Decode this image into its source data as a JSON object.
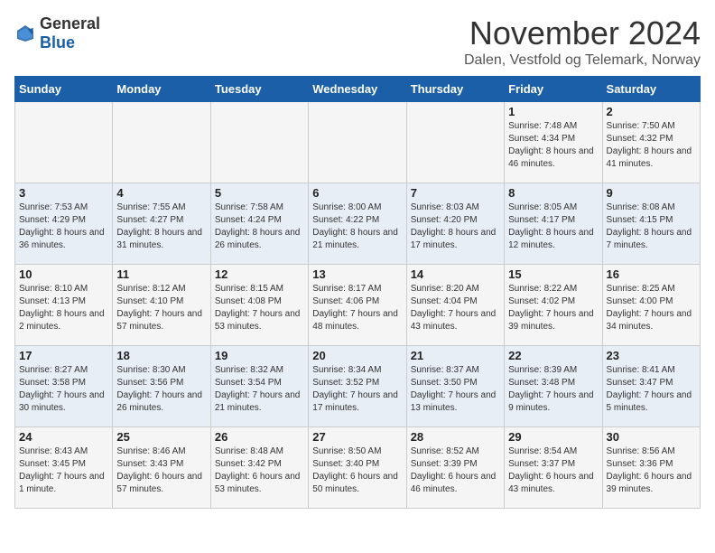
{
  "header": {
    "logo_general": "General",
    "logo_blue": "Blue",
    "month_title": "November 2024",
    "subtitle": "Dalen, Vestfold og Telemark, Norway"
  },
  "days_of_week": [
    "Sunday",
    "Monday",
    "Tuesday",
    "Wednesday",
    "Thursday",
    "Friday",
    "Saturday"
  ],
  "weeks": [
    [
      {
        "day": "",
        "info": ""
      },
      {
        "day": "",
        "info": ""
      },
      {
        "day": "",
        "info": ""
      },
      {
        "day": "",
        "info": ""
      },
      {
        "day": "",
        "info": ""
      },
      {
        "day": "1",
        "info": "Sunrise: 7:48 AM\nSunset: 4:34 PM\nDaylight: 8 hours and 46 minutes."
      },
      {
        "day": "2",
        "info": "Sunrise: 7:50 AM\nSunset: 4:32 PM\nDaylight: 8 hours and 41 minutes."
      }
    ],
    [
      {
        "day": "3",
        "info": "Sunrise: 7:53 AM\nSunset: 4:29 PM\nDaylight: 8 hours and 36 minutes."
      },
      {
        "day": "4",
        "info": "Sunrise: 7:55 AM\nSunset: 4:27 PM\nDaylight: 8 hours and 31 minutes."
      },
      {
        "day": "5",
        "info": "Sunrise: 7:58 AM\nSunset: 4:24 PM\nDaylight: 8 hours and 26 minutes."
      },
      {
        "day": "6",
        "info": "Sunrise: 8:00 AM\nSunset: 4:22 PM\nDaylight: 8 hours and 21 minutes."
      },
      {
        "day": "7",
        "info": "Sunrise: 8:03 AM\nSunset: 4:20 PM\nDaylight: 8 hours and 17 minutes."
      },
      {
        "day": "8",
        "info": "Sunrise: 8:05 AM\nSunset: 4:17 PM\nDaylight: 8 hours and 12 minutes."
      },
      {
        "day": "9",
        "info": "Sunrise: 8:08 AM\nSunset: 4:15 PM\nDaylight: 8 hours and 7 minutes."
      }
    ],
    [
      {
        "day": "10",
        "info": "Sunrise: 8:10 AM\nSunset: 4:13 PM\nDaylight: 8 hours and 2 minutes."
      },
      {
        "day": "11",
        "info": "Sunrise: 8:12 AM\nSunset: 4:10 PM\nDaylight: 7 hours and 57 minutes."
      },
      {
        "day": "12",
        "info": "Sunrise: 8:15 AM\nSunset: 4:08 PM\nDaylight: 7 hours and 53 minutes."
      },
      {
        "day": "13",
        "info": "Sunrise: 8:17 AM\nSunset: 4:06 PM\nDaylight: 7 hours and 48 minutes."
      },
      {
        "day": "14",
        "info": "Sunrise: 8:20 AM\nSunset: 4:04 PM\nDaylight: 7 hours and 43 minutes."
      },
      {
        "day": "15",
        "info": "Sunrise: 8:22 AM\nSunset: 4:02 PM\nDaylight: 7 hours and 39 minutes."
      },
      {
        "day": "16",
        "info": "Sunrise: 8:25 AM\nSunset: 4:00 PM\nDaylight: 7 hours and 34 minutes."
      }
    ],
    [
      {
        "day": "17",
        "info": "Sunrise: 8:27 AM\nSunset: 3:58 PM\nDaylight: 7 hours and 30 minutes."
      },
      {
        "day": "18",
        "info": "Sunrise: 8:30 AM\nSunset: 3:56 PM\nDaylight: 7 hours and 26 minutes."
      },
      {
        "day": "19",
        "info": "Sunrise: 8:32 AM\nSunset: 3:54 PM\nDaylight: 7 hours and 21 minutes."
      },
      {
        "day": "20",
        "info": "Sunrise: 8:34 AM\nSunset: 3:52 PM\nDaylight: 7 hours and 17 minutes."
      },
      {
        "day": "21",
        "info": "Sunrise: 8:37 AM\nSunset: 3:50 PM\nDaylight: 7 hours and 13 minutes."
      },
      {
        "day": "22",
        "info": "Sunrise: 8:39 AM\nSunset: 3:48 PM\nDaylight: 7 hours and 9 minutes."
      },
      {
        "day": "23",
        "info": "Sunrise: 8:41 AM\nSunset: 3:47 PM\nDaylight: 7 hours and 5 minutes."
      }
    ],
    [
      {
        "day": "24",
        "info": "Sunrise: 8:43 AM\nSunset: 3:45 PM\nDaylight: 7 hours and 1 minute."
      },
      {
        "day": "25",
        "info": "Sunrise: 8:46 AM\nSunset: 3:43 PM\nDaylight: 6 hours and 57 minutes."
      },
      {
        "day": "26",
        "info": "Sunrise: 8:48 AM\nSunset: 3:42 PM\nDaylight: 6 hours and 53 minutes."
      },
      {
        "day": "27",
        "info": "Sunrise: 8:50 AM\nSunset: 3:40 PM\nDaylight: 6 hours and 50 minutes."
      },
      {
        "day": "28",
        "info": "Sunrise: 8:52 AM\nSunset: 3:39 PM\nDaylight: 6 hours and 46 minutes."
      },
      {
        "day": "29",
        "info": "Sunrise: 8:54 AM\nSunset: 3:37 PM\nDaylight: 6 hours and 43 minutes."
      },
      {
        "day": "30",
        "info": "Sunrise: 8:56 AM\nSunset: 3:36 PM\nDaylight: 6 hours and 39 minutes."
      }
    ]
  ]
}
